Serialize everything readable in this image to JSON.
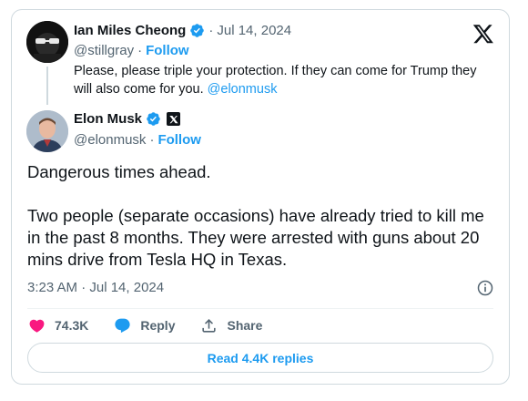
{
  "quoted": {
    "name": "Ian Miles Cheong",
    "date": "Jul 14, 2024",
    "handle": "@stillgray",
    "follow": "Follow",
    "text": "Please, please triple your protection. If they can come for Trump they will also come for you.",
    "mention": "@elonmusk"
  },
  "tweet": {
    "name": "Elon Musk",
    "handle": "@elonmusk",
    "follow": "Follow",
    "line1": "Dangerous times ahead.",
    "line2": "Two people (separate occasions) have already tried to kill me in the past 8 months. They were arrested with guns about 20 mins drive from Tesla HQ in Texas.",
    "timestamp": "3:23 AM · Jul 14, 2024"
  },
  "actions": {
    "likes": "74.3K",
    "reply": "Reply",
    "share": "Share"
  },
  "replies_button": "Read 4.4K replies",
  "separator": "·",
  "colors": {
    "accent": "#1d9bf0",
    "like": "#f91880",
    "text": "#0f1419",
    "muted": "#536471",
    "border": "#cfd9de"
  },
  "icons": [
    "x-logo-icon",
    "verified-badge-icon",
    "x-affiliate-badge-icon",
    "info-icon",
    "heart-icon",
    "reply-bubble-icon",
    "share-icon"
  ]
}
